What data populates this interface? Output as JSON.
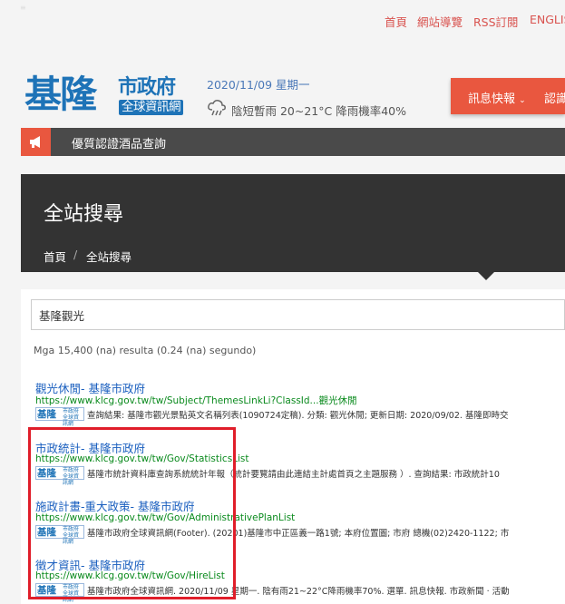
{
  "topnav": {
    "items": [
      "首頁",
      "網站導覽",
      "RSS訂閱",
      "ENGLISH"
    ]
  },
  "skip": "≡",
  "logo": {
    "big": "基隆",
    "small1": "市政府",
    "small2": "全球資訊網"
  },
  "date": "2020/11/09 星期一",
  "weather": "陰短暫雨 20~21°C 降雨機率40%",
  "orangebar": {
    "item1": "訊息快報",
    "item2": "認識"
  },
  "marquee": {
    "text": "優質認證酒品查詢"
  },
  "page": {
    "title": "全站搜尋",
    "breadcrumb": [
      "首頁",
      "/",
      "全站搜尋"
    ]
  },
  "search": {
    "value": "基隆觀光"
  },
  "stats": "Mga 15,400 (na) resulta (0.24 (na) segundo)",
  "thumb": {
    "t1": "基隆",
    "t2": "市政府 全球資訊網"
  },
  "results": [
    {
      "title": "觀光休閒- 基隆市政府",
      "url": "https://www.klcg.gov.tw/tw/Subject/ThemesLinkLi?ClassId...觀光休閒",
      "snippet": "查詢結果: 基隆市觀光景點英文名稱列表(1090724定稿). 分類: 觀光休閒; 更新日期: 2020/09/02. 基隆即時交"
    },
    {
      "title": "市政統計- 基隆市政府",
      "url": "https://www.klcg.gov.tw/tw/Gov/StatisticsList",
      "snippet": "基隆市統計資料庫查詢系統統計年報（統計要覽請由此連結主計處首頁之主題服務 ）. 查詢結果: 市政統計10"
    },
    {
      "title": "施政計畫-重大政策- 基隆市政府",
      "url": "https://www.klcg.gov.tw/tw/Gov/AdministrativePlanList",
      "snippet": "基隆市政府全球資訊網(Footer). (20201)基隆市中正區義一路1號; 本府位置圖; 市府 總機(02)2420-1122; 市"
    },
    {
      "title": "徵才資訊- 基隆市政府",
      "url": "https://www.klcg.gov.tw/tw/Gov/HireList",
      "snippet": "基隆市政府全球資訊網. 2020/11/09 星期一. 陰有雨21~22°C降雨機率70%. 選單. 訊息快報. 市政新聞 · 活動"
    }
  ],
  "colors": {
    "accent": "#e9573f",
    "link": "#1a5fbf",
    "url": "#0a8a1d",
    "highlight": "#e01e2a"
  }
}
